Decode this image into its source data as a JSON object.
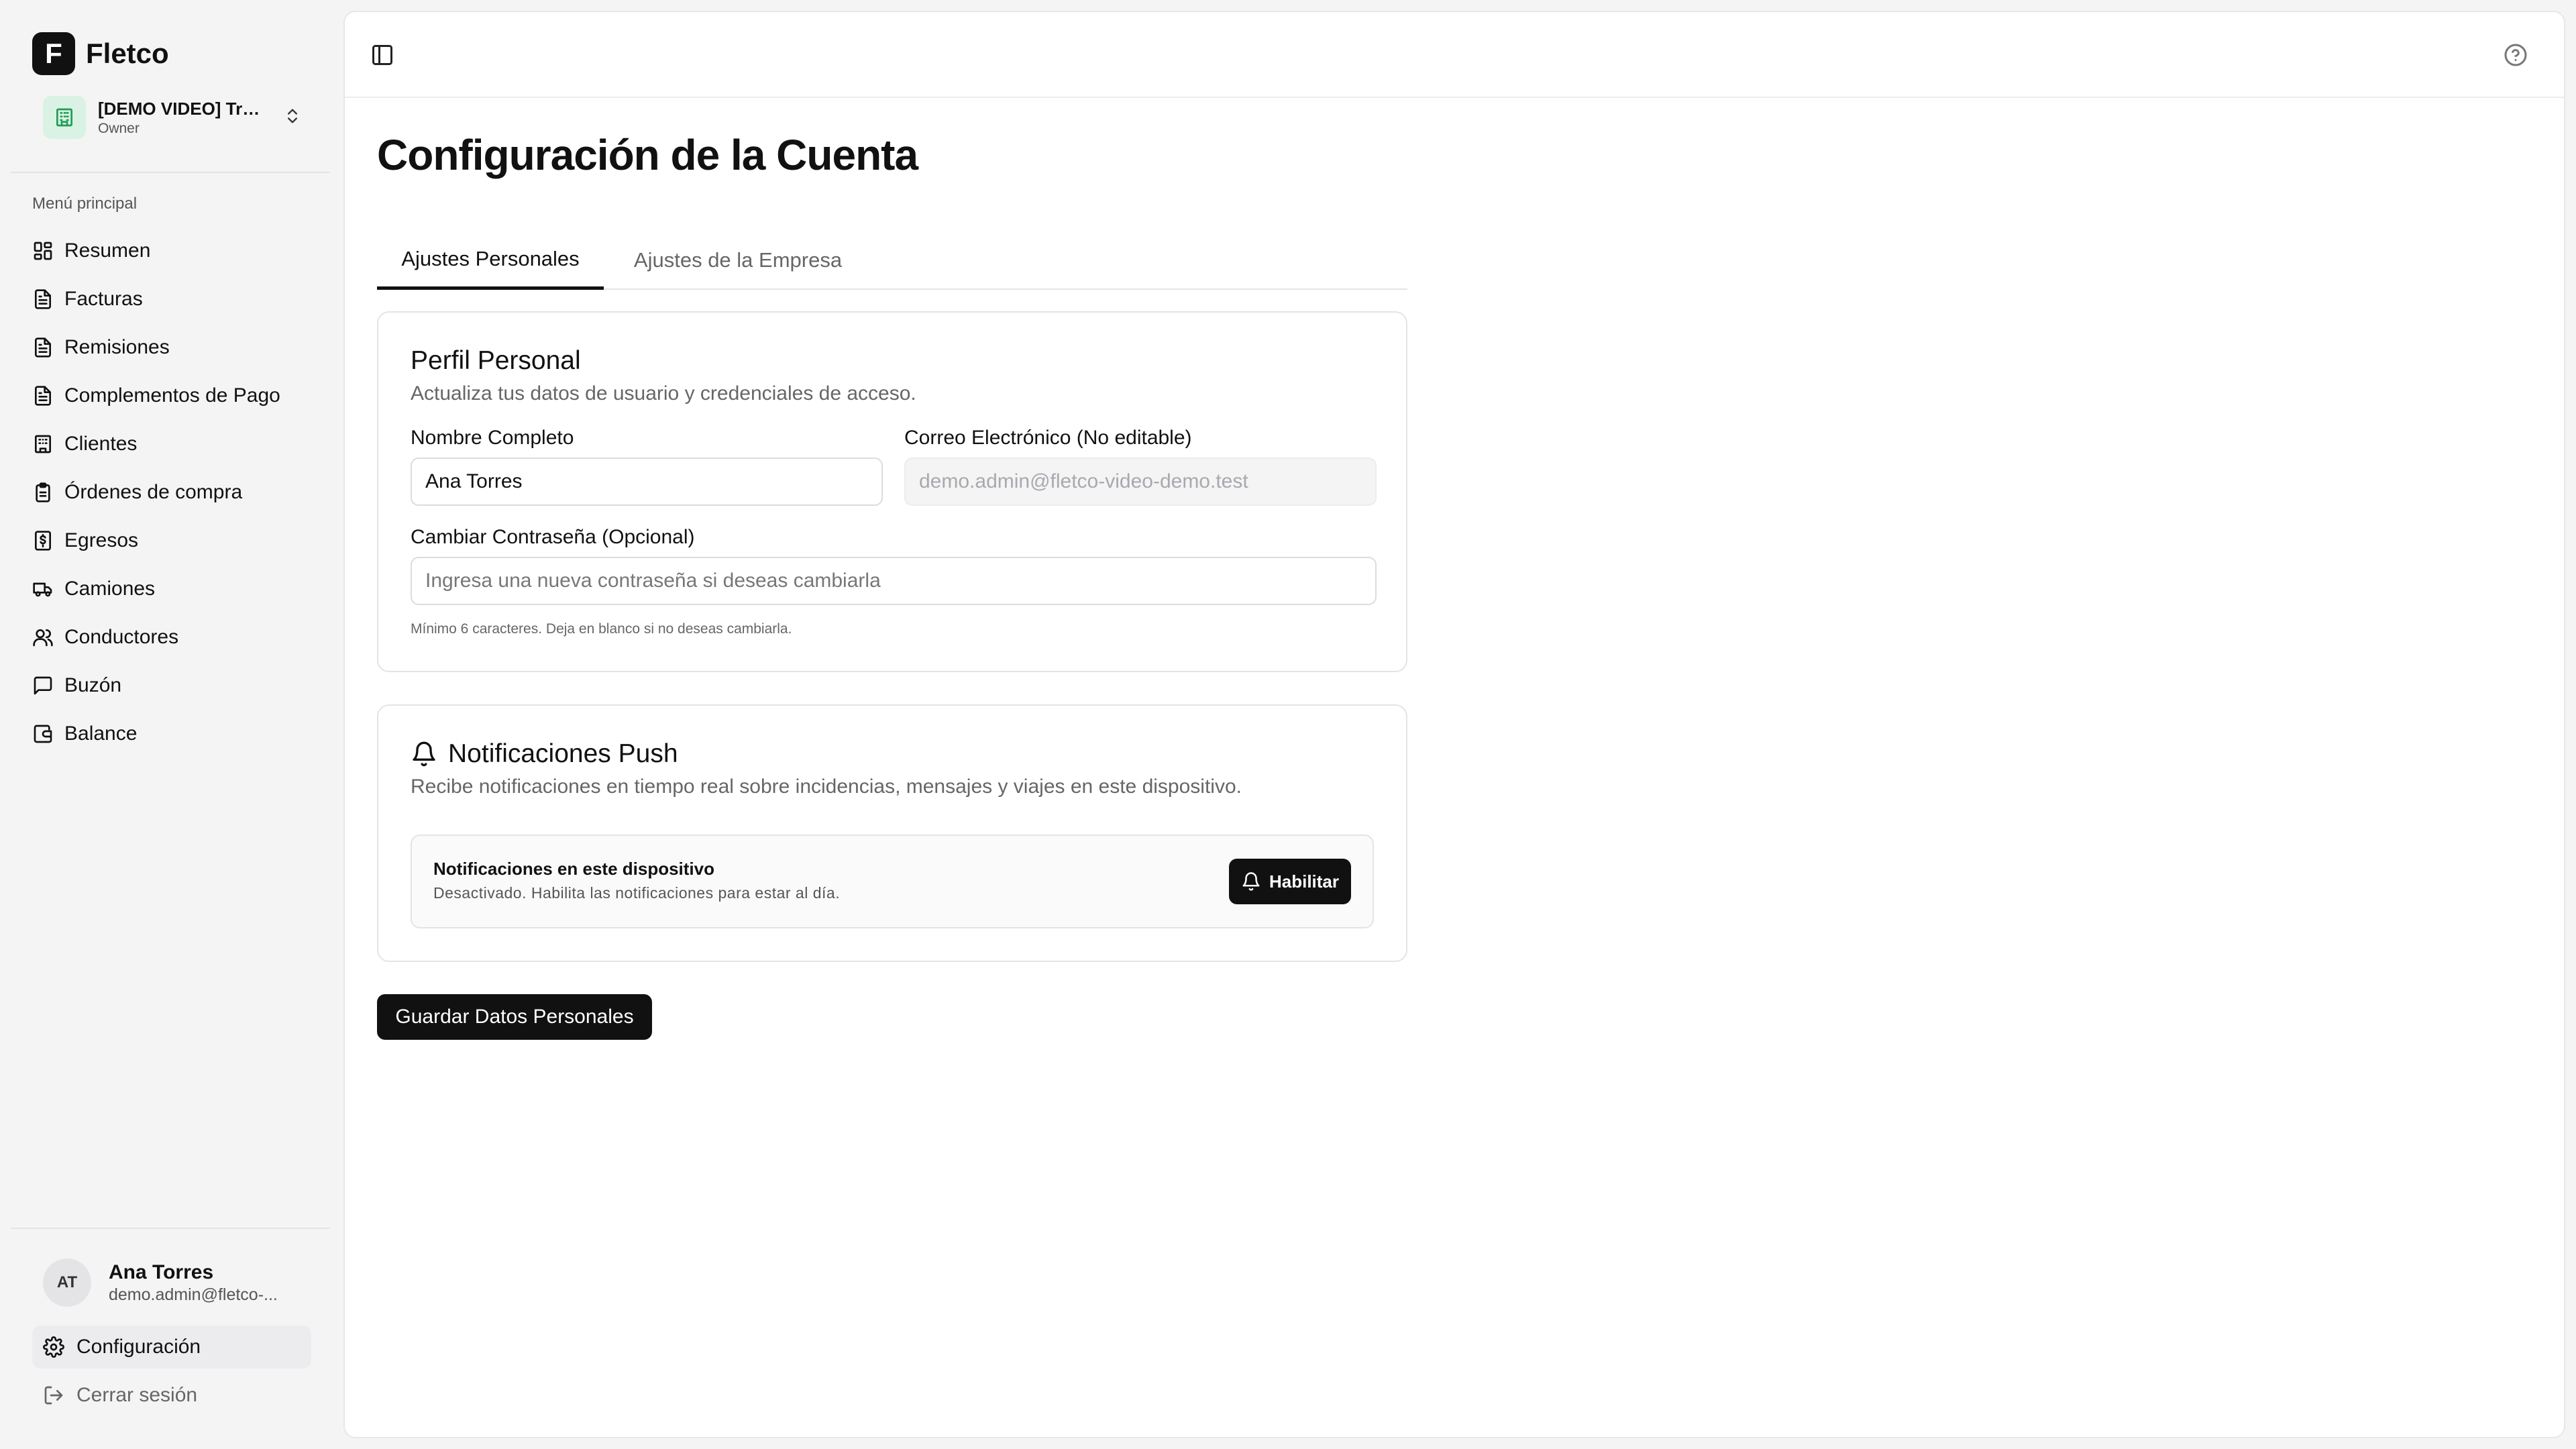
{
  "brand": {
    "logo_letter": "F",
    "name": "Fletco"
  },
  "org": {
    "name": "[DEMO VIDEO] Tra...",
    "role": "Owner"
  },
  "sidebar": {
    "section_label": "Menú principal",
    "items": [
      {
        "label": "Resumen",
        "icon": "dashboard-icon"
      },
      {
        "label": "Facturas",
        "icon": "document-icon"
      },
      {
        "label": "Remisiones",
        "icon": "document-icon"
      },
      {
        "label": "Complementos de Pago",
        "icon": "document-icon"
      },
      {
        "label": "Clientes",
        "icon": "building-icon"
      },
      {
        "label": "Órdenes de compra",
        "icon": "clipboard-icon"
      },
      {
        "label": "Egresos",
        "icon": "dollar-icon"
      },
      {
        "label": "Camiones",
        "icon": "truck-icon"
      },
      {
        "label": "Conductores",
        "icon": "users-icon"
      },
      {
        "label": "Buzón",
        "icon": "message-icon"
      },
      {
        "label": "Balance",
        "icon": "wallet-icon"
      }
    ]
  },
  "user": {
    "initials": "AT",
    "name": "Ana Torres",
    "email": "demo.admin@fletco-..."
  },
  "footer": {
    "settings_label": "Configuración",
    "logout_label": "Cerrar sesión"
  },
  "page": {
    "title": "Configuración de la Cuenta",
    "tabs": [
      {
        "label": "Ajustes Personales"
      },
      {
        "label": "Ajustes de la Empresa"
      }
    ]
  },
  "profile": {
    "title": "Perfil Personal",
    "subtitle": "Actualiza tus datos de usuario y credenciales de acceso.",
    "name_label": "Nombre Completo",
    "name_value": "Ana Torres",
    "email_label": "Correo Electrónico (No editable)",
    "email_placeholder": "demo.admin@fletco-video-demo.test",
    "password_label": "Cambiar Contraseña (Opcional)",
    "password_placeholder": "Ingresa una nueva contraseña si deseas cambiarla",
    "password_hint": "Mínimo 6 caracteres. Deja en blanco si no deseas cambiarla."
  },
  "notifications": {
    "title": "Notificaciones Push",
    "subtitle": "Recibe notificaciones en tiempo real sobre incidencias, mensajes y viajes en este dispositivo.",
    "device_title": "Notificaciones en este dispositivo",
    "device_desc": "Desactivado. Habilita las notificaciones para estar al día.",
    "enable_label": "Habilitar"
  },
  "save_label": "Guardar Datos Personales",
  "colors": {
    "accent": "#111111",
    "org_icon_bg": "#d9f2e3",
    "org_icon": "#1f9d55"
  }
}
